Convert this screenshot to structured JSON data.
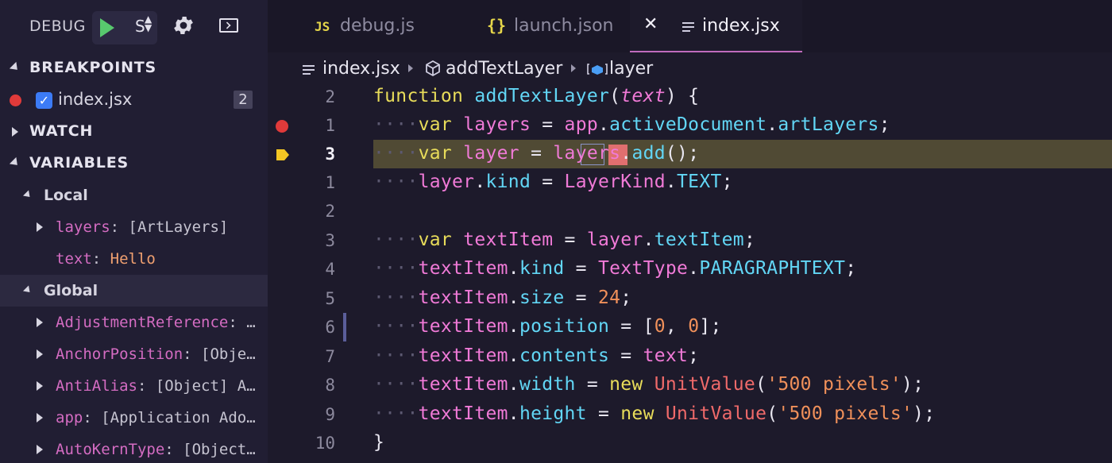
{
  "debug": {
    "label": "DEBUG",
    "config_glyph": "S"
  },
  "sidebar": {
    "breakpoints": {
      "title": "BREAKPOINTS",
      "items": [
        {
          "file": "index.jsx",
          "count": "2"
        }
      ]
    },
    "watch": {
      "title": "WATCH"
    },
    "variables": {
      "title": "VARIABLES",
      "local": {
        "title": "Local",
        "items": [
          {
            "name": "layers",
            "rest": ": [ArtLayers]"
          },
          {
            "name": "text",
            "rest": ": ",
            "value": "Hello"
          }
        ]
      },
      "global": {
        "title": "Global",
        "items": [
          {
            "name": "AdjustmentReference",
            "rest": ": …"
          },
          {
            "name": "AnchorPosition",
            "rest": ": [Obje…"
          },
          {
            "name": "AntiAlias",
            "rest": ": [Object] A…"
          },
          {
            "name": "app",
            "rest": ": [Application Ado…"
          },
          {
            "name": "AutoKernType",
            "rest": ": [Object…"
          }
        ]
      }
    }
  },
  "tabs": [
    {
      "label": "debug.js",
      "icon": "JS"
    },
    {
      "label": "launch.json",
      "icon": "{}"
    },
    {
      "label": "index.jsx",
      "icon": "lines-icon",
      "active": true
    }
  ],
  "breadcrumb": {
    "file": "index.jsx",
    "function": "addTextLayer",
    "variable": "layer"
  },
  "code": {
    "line_numbers": [
      "2",
      "1",
      "3",
      "1",
      "2",
      "3",
      "4",
      "5",
      "6",
      "7",
      "8",
      "9",
      "10"
    ],
    "l0": {
      "kw": "function",
      "fn": "addTextLayer",
      "open": "(",
      "param": "text",
      "close": ") {"
    },
    "l1": {
      "kw": "var",
      "v": "layers",
      "eq": " = ",
      "obj": "app",
      "d1": ".",
      "p1": "activeDocument",
      "d2": ".",
      "p2": "artLayers",
      "semi": ";"
    },
    "l2": {
      "kw": "var",
      "v": "layer",
      "eq": " = ",
      "obj": "layers",
      "d1": ".",
      "fn": "add",
      "paren": "()",
      "semi": ";"
    },
    "l3": {
      "v": "layer",
      "d1": ".",
      "p1": "kind",
      "eq": " = ",
      "cls": "LayerKind",
      "d2": ".",
      "c": "TEXT",
      "semi": ";"
    },
    "l5": {
      "kw": "var",
      "v": "textItem",
      "eq": " = ",
      "obj": "layer",
      "d1": ".",
      "p1": "textItem",
      "semi": ";"
    },
    "l6": {
      "v": "textItem",
      "d1": ".",
      "p1": "kind",
      "eq": " = ",
      "cls": "TextType",
      "d2": ".",
      "c": "PARAGRAPHTEXT",
      "semi": ";"
    },
    "l7": {
      "v": "textItem",
      "d1": ".",
      "p1": "size",
      "eq": " = ",
      "num": "24",
      "semi": ";"
    },
    "l8": {
      "v": "textItem",
      "d1": ".",
      "p1": "position",
      "eq": " = ",
      "ob": "[",
      "n1": "0",
      "comma": ", ",
      "n2": "0",
      "cb": "];"
    },
    "l9": {
      "v": "textItem",
      "d1": ".",
      "p1": "contents",
      "eq": " = ",
      "val": "text",
      "semi": ";"
    },
    "l10": {
      "v": "textItem",
      "d1": ".",
      "p1": "width",
      "eq": " = ",
      "kw": "new",
      "cls": "UnitValue",
      "op": "(",
      "str": "'500 pixels'",
      "cp": ");"
    },
    "l11": {
      "v": "textItem",
      "d1": ".",
      "p1": "height",
      "eq": " = ",
      "kw": "new",
      "cls": "UnitValue",
      "op": "(",
      "str": "'500 pixels'",
      "cp": ");"
    },
    "l12": {
      "brace": "}"
    }
  },
  "colors": {
    "keyword": "#e8dc5a",
    "function": "#62d6f5",
    "variable": "#f07ad7",
    "number": "#f0905a",
    "breakpoint": "#e03a3a",
    "current_line": "#504a34"
  }
}
